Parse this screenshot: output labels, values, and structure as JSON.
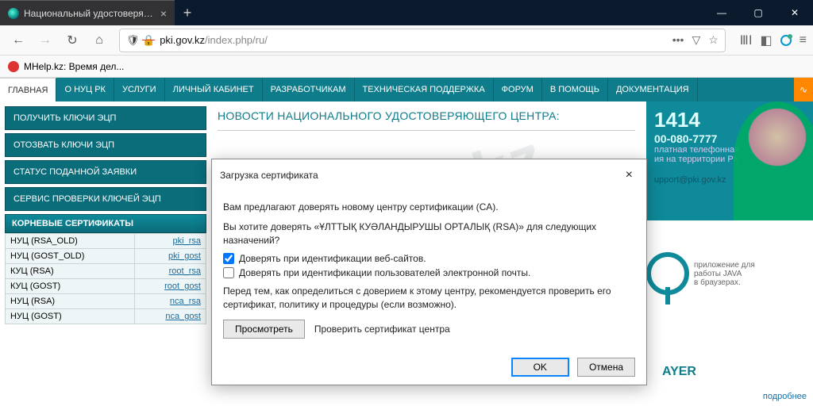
{
  "window": {
    "tab_title": "Национальный удостоверяющ",
    "bookmark": "MHelp.kz: Время дел..."
  },
  "addr": {
    "domain": "pki.gov.kz",
    "path": "/index.php/ru/"
  },
  "nav": {
    "items": [
      "ГЛАВНАЯ",
      "О НУЦ РК",
      "УСЛУГИ",
      "ЛИЧНЫЙ КАБИНЕТ",
      "РАЗРАБОТЧИКАМ",
      "ТЕХНИЧЕСКАЯ ПОДДЕРЖКА",
      "ФОРУМ",
      "В ПОМОЩЬ",
      "ДОКУМЕНТАЦИЯ"
    ]
  },
  "sidebar": {
    "btns": [
      "ПОЛУЧИТЬ КЛЮЧИ ЭЦП",
      "ОТОЗВАТЬ КЛЮЧИ ЭЦП",
      "СТАТУС ПОДАННОЙ ЗАЯВКИ",
      "СЕРВИС ПРОВЕРКИ КЛЮЧЕЙ ЭЦП"
    ],
    "certs_header": "КОРНЕВЫЕ СЕРТИФИКАТЫ",
    "certs": [
      {
        "name": "НУЦ (RSA_OLD)",
        "link": "pki_rsa"
      },
      {
        "name": "НУЦ (GOST_OLD)",
        "link": "pki_gost"
      },
      {
        "name": "КУЦ (RSA)",
        "link": "root_rsa"
      },
      {
        "name": "КУЦ (GOST)",
        "link": "root_gost"
      },
      {
        "name": "НУЦ (RSA)",
        "link": "nca_rsa"
      },
      {
        "name": "НУЦ (GOST)",
        "link": "nca_gost"
      }
    ]
  },
  "main": {
    "news_header": "НОВОСТИ НАЦИОНАЛЬНОГО УДОСТОВЕРЯЮЩЕГО ЦЕНТРА:"
  },
  "right": {
    "short": "1414",
    "phone": "00-080-7777",
    "line1": "платная телефонная",
    "line2": "ия на территории РК",
    "email": "upport@pki.gov.kz",
    "nca_label": "AYER",
    "nca_desc1": "приложение для",
    "nca_desc2": "работы JAVA",
    "nca_desc3": "в браузерах.",
    "more": "подробнее"
  },
  "dialog": {
    "title": "Загрузка сертификата",
    "p1": "Вам предлагают доверять новому центру сертификации (CA).",
    "p2": "Вы хотите доверять «ҰЛТТЫҚ КУӘЛАНДЫРУШЫ ОРТАЛЫҚ (RSA)» для следующих назначений?",
    "chk1": "Доверять при идентификации веб-сайтов.",
    "chk2": "Доверять при идентификации пользователей электронной почты.",
    "p3": "Перед тем, как определиться с доверием к этому центру, рекомендуется проверить его сертификат, политику и процедуры (если возможно).",
    "view_btn": "Просмотреть",
    "view_label": "Проверить сертификат центра",
    "ok": "OK",
    "cancel": "Отмена"
  },
  "watermark": "MHelp.kz"
}
